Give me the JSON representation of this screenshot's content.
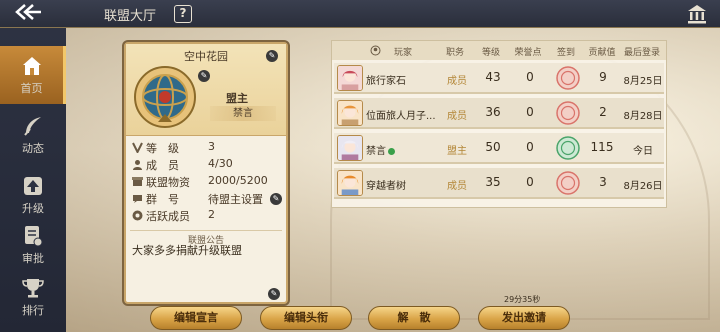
{
  "topbar": {
    "title": "联盟大厅",
    "help_label": "?"
  },
  "sidebar": {
    "items": [
      {
        "label": "首页",
        "icon": "home-icon",
        "active": true
      },
      {
        "label": "动态",
        "icon": "feather-icon",
        "active": false
      },
      {
        "label": "升级",
        "icon": "upgrade-icon",
        "active": false
      },
      {
        "label": "审批",
        "icon": "approve-icon",
        "active": false
      },
      {
        "label": "排行",
        "icon": "trophy-icon",
        "active": false
      }
    ]
  },
  "guild": {
    "name": "空中花园",
    "leader_title": "盟主",
    "leader_name": "禁言",
    "stats": [
      {
        "label": "等　级",
        "value": "3"
      },
      {
        "label": "成　员",
        "value": "4/30"
      },
      {
        "label": "联盟物资",
        "value": "2000/5200"
      },
      {
        "label": "群　号",
        "value": "待盟主设置"
      },
      {
        "label": "活跃成员",
        "value": "2"
      }
    ],
    "notice_title": "联盟公告",
    "notice_text": "大家多多捐献升级联盟"
  },
  "table": {
    "headers": [
      "玩家",
      "职务",
      "等级",
      "荣誉点",
      "签到",
      "贡献值",
      "最后登录"
    ],
    "rows": [
      {
        "name": "旅行家石",
        "role": "成员",
        "level": "43",
        "honor": "0",
        "checkin": "red",
        "contribution": "9",
        "last_login": "8月25日",
        "online": false
      },
      {
        "name": "位面旅人月子...",
        "role": "成员",
        "level": "36",
        "honor": "0",
        "checkin": "red",
        "contribution": "2",
        "last_login": "8月28日",
        "online": false
      },
      {
        "name": "禁言",
        "role": "盟主",
        "level": "50",
        "honor": "0",
        "checkin": "green",
        "contribution": "115",
        "last_login": "今日",
        "online": true
      },
      {
        "name": "穿越者树",
        "role": "成员",
        "level": "35",
        "honor": "0",
        "checkin": "red",
        "contribution": "3",
        "last_login": "8月26日",
        "online": false
      }
    ]
  },
  "buttons": {
    "edit_notice": "编辑宣言",
    "edit_title": "编辑头衔",
    "disband": "解　散",
    "invite": "发出邀请"
  },
  "timer_text": "29分35秒",
  "colors": {
    "accent_gold": "#d9a447",
    "sidebar_bg": "#2d3242",
    "checkin_red": "#d9736a",
    "checkin_green": "#4aa46a"
  }
}
